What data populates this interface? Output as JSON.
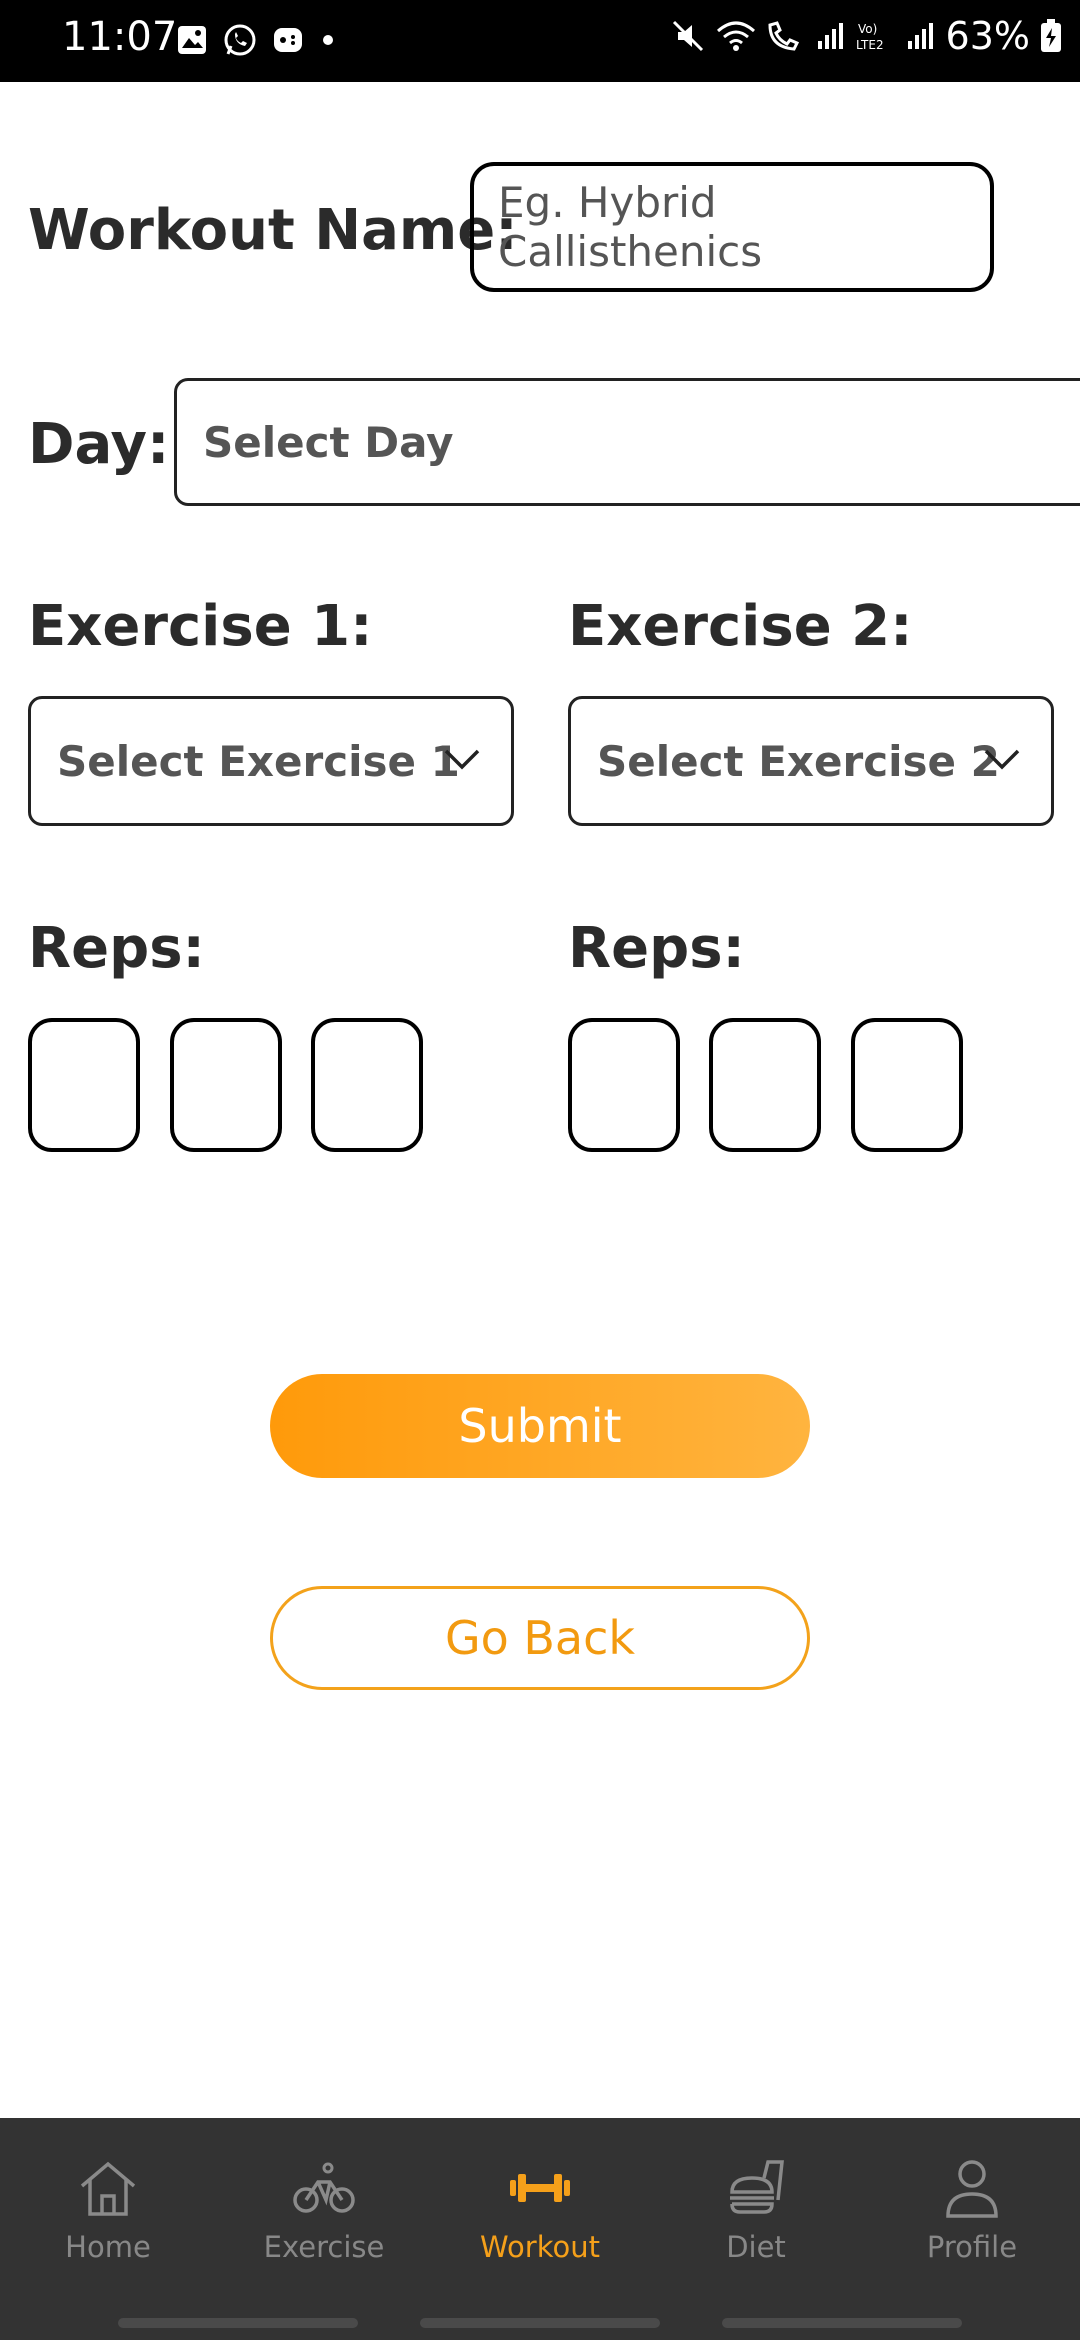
{
  "status_bar": {
    "time": "11:07",
    "battery": "63%"
  },
  "form": {
    "workout_name_label": "Workout Name:",
    "workout_name_placeholder": "Eg. Hybrid Callisthenics",
    "day_label": "Day:",
    "day_placeholder": "Select Day",
    "exercise1_label": "Exercise 1:",
    "exercise1_placeholder": "Select Exercise 1",
    "exercise2_label": "Exercise 2:",
    "exercise2_placeholder": "Select Exercise 2",
    "reps1_label": "Reps:",
    "reps2_label": "Reps:"
  },
  "buttons": {
    "submit": "Submit",
    "go_back": "Go Back"
  },
  "nav": {
    "items": [
      {
        "label": "Home",
        "icon": "home-icon"
      },
      {
        "label": "Exercise",
        "icon": "bicycle-icon"
      },
      {
        "label": "Workout",
        "icon": "dumbbell-icon",
        "active": true
      },
      {
        "label": "Diet",
        "icon": "food-icon"
      },
      {
        "label": "Profile",
        "icon": "person-icon"
      }
    ]
  },
  "colors": {
    "accent": "#f5a01a",
    "nav_bg": "#333333"
  }
}
